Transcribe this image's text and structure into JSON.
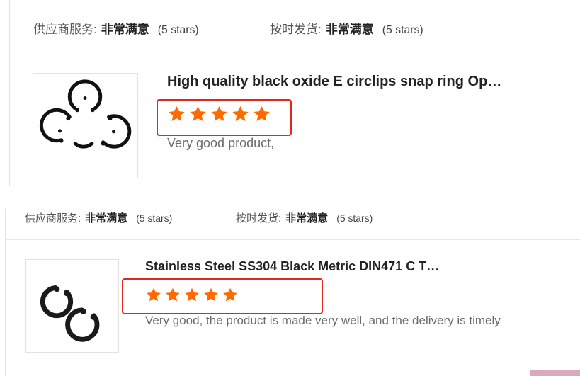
{
  "reviews": [
    {
      "supplier_service": {
        "label": "供应商服务:",
        "value": "非常满意",
        "stars_text": "(5 stars)"
      },
      "on_time_delivery": {
        "label": "按时发货:",
        "value": "非常满意",
        "stars_text": "(5 stars)"
      },
      "product_title": "High quality black oxide E circlips snap ring Op…",
      "rating": 5,
      "comment": "Very good product,",
      "image_icon": "e-circlip-icon"
    },
    {
      "supplier_service": {
        "label": "供应商服务:",
        "value": "非常满意",
        "stars_text": "(5 stars)"
      },
      "on_time_delivery": {
        "label": "按时发货:",
        "value": "非常满意",
        "stars_text": "(5 stars)"
      },
      "product_title": "Stainless Steel SS304 Black Metric DIN471 C T…",
      "rating": 5,
      "comment": "Very good, the product is made very well, and the delivery is timely",
      "image_icon": "retaining-ring-icon"
    }
  ],
  "colors": {
    "star": "#ff6a00",
    "highlight_box": "#e0261d"
  }
}
